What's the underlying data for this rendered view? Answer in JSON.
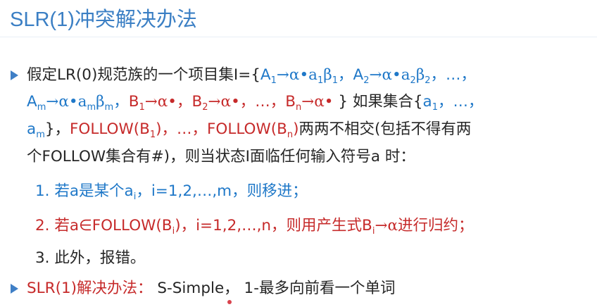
{
  "title": "SLR(1)冲突解决办法",
  "bullet1": {
    "l1": {
      "pre": "假定LR(0)规范族的一个项目集I={",
      "i1": "A",
      "i1s": "1",
      "i1r": "→α•a",
      "i1s2": "1",
      "i1r2": "β",
      "i1s3": "1",
      "sep1": "，",
      "i2": "A",
      "i2s": "2",
      "i2r": "→α•a",
      "i2s2": "2",
      "i2r2": "β",
      "i2s3": "2",
      "tail": "，…，"
    },
    "l2": {
      "i3": "A",
      "i3s": "m",
      "i3r": "→α•a",
      "i3s2": "m",
      "i3r2": "β",
      "i3s3": "m",
      "sep1": "，",
      "b1": "B",
      "b1s": "1",
      "b1r": "→α•",
      "sep2": "，",
      "b2": "B",
      "b2s": "2",
      "b2r": "→α•",
      "sep3": "，…，",
      "bn": "B",
      "bns": "n",
      "bnr": "→α•",
      "close": " } ",
      "cond": "如果集合{",
      "a1": "a",
      "a1s": "1",
      "tail": "，…，"
    },
    "l3": {
      "am": "a",
      "ams": "m",
      "close": "}，",
      "f1": "FOLLOW(B",
      "f1s": "1",
      "f1r": ")",
      "sep": "，…，",
      "fn": "FOLLOW(B",
      "fns": "n",
      "fnr": ")",
      "tail": "两两不相交(包括不得有两"
    },
    "l4": "个FOLLOW集合有#)，则当状态I面临任何输入符号a 时："
  },
  "items": {
    "i1": {
      "pre": "1. 若a是某个a",
      "sub": "i",
      "post": "，i=1,2,…,m，则移进；"
    },
    "i2": {
      "pre": "2. 若a∈FOLLOW(B",
      "sub": "i",
      "mid": ")，i=1,2,…,n，则用产生式B",
      "sub2": "i",
      "post": "→α进行归约；"
    },
    "i3": "3. 此外，报错。"
  },
  "bullet2": {
    "label": "SLR(1)解决办法：",
    "text": " S-Simple， 1-最多向前看一个单词"
  },
  "colors": {
    "title": "#3b7fc4",
    "blue": "#1f78c8",
    "red": "#c62a2a",
    "text": "#262626",
    "bullet": "#3f7fc6"
  }
}
